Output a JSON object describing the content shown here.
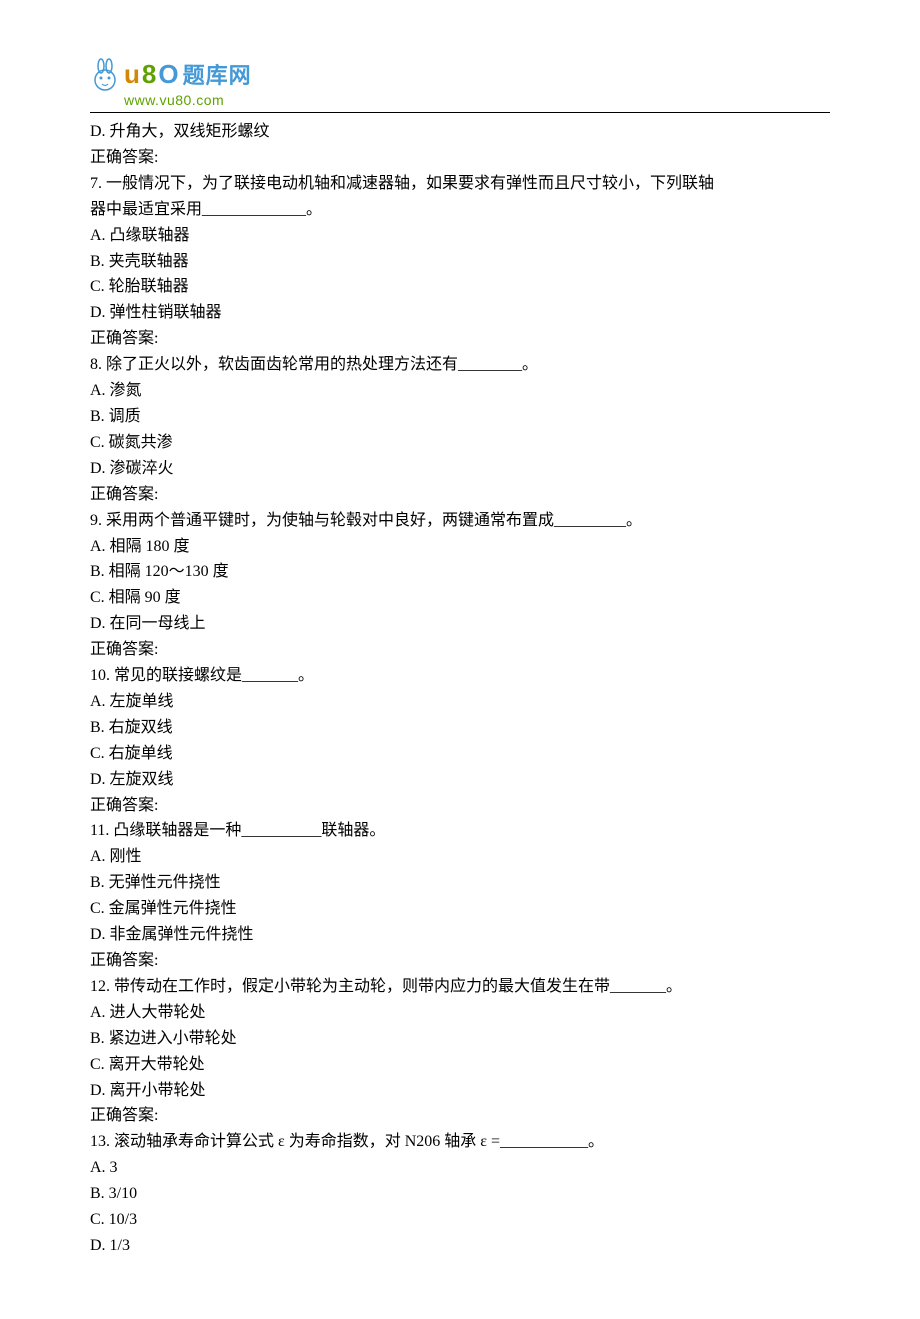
{
  "logo": {
    "u": "u",
    "eight": "8",
    "zero": "O",
    "cn": "题库网",
    "url": "www.vu80.com"
  },
  "preD": "D.  升角大，双线矩形螺纹",
  "preAnswer": "正确答案:",
  "q7": {
    "stem1": "7.    一般情况下，为了联接电动机轴和减速器轴，如果要求有弹性而且尺寸较小，下列联轴",
    "stem2": "器中最适宜采用_____________。",
    "A": "A.  凸缘联轴器",
    "B": "B.  夹壳联轴器",
    "C": "C.  轮胎联轴器",
    "D": "D.  弹性柱销联轴器",
    "ans": "正确答案:"
  },
  "q8": {
    "stem": "8.    除了正火以外，软齿面齿轮常用的热处理方法还有________。",
    "A": "A.  渗氮",
    "B": "B.  调质",
    "C": "C.  碳氮共渗",
    "D": "D.  渗碳淬火",
    "ans": "正确答案:"
  },
  "q9": {
    "stem": "9.    采用两个普通平键时，为使轴与轮毂对中良好，两键通常布置成_________。",
    "A": "A.  相隔 180 度",
    "B": "B.  相隔 120～130 度",
    "C": "C.  相隔 90 度",
    "D": "D.  在同一母线上",
    "ans": "正确答案:"
  },
  "q10": {
    "stem": "10.    常见的联接螺纹是_______。",
    "A": "A.  左旋单线",
    "B": "B.  右旋双线",
    "C": "C.  右旋单线",
    "D": "D.  左旋双线",
    "ans": "正确答案:"
  },
  "q11": {
    "stem": "11.    凸缘联轴器是一种__________联轴器。",
    "A": "A.  刚性",
    "B": "B.  无弹性元件挠性",
    "C": "C.  金属弹性元件挠性",
    "D": "D.  非金属弹性元件挠性",
    "ans": "正确答案:"
  },
  "q12": {
    "stem": "12.    带传动在工作时，假定小带轮为主动轮，则带内应力的最大值发生在带_______。",
    "A": "A.  进人大带轮处",
    "B": "B.  紧边进入小带轮处",
    "C": "C.  离开大带轮处",
    "D": "D.  离开小带轮处",
    "ans": "正确答案:"
  },
  "q13": {
    "stem": "13.    滚动轴承寿命计算公式 ε 为寿命指数，对 N206 轴承 ε =___________。",
    "A": "A. 3",
    "B": "B. 3/10",
    "C": "C. 10/3",
    "D": "D. 1/3"
  }
}
